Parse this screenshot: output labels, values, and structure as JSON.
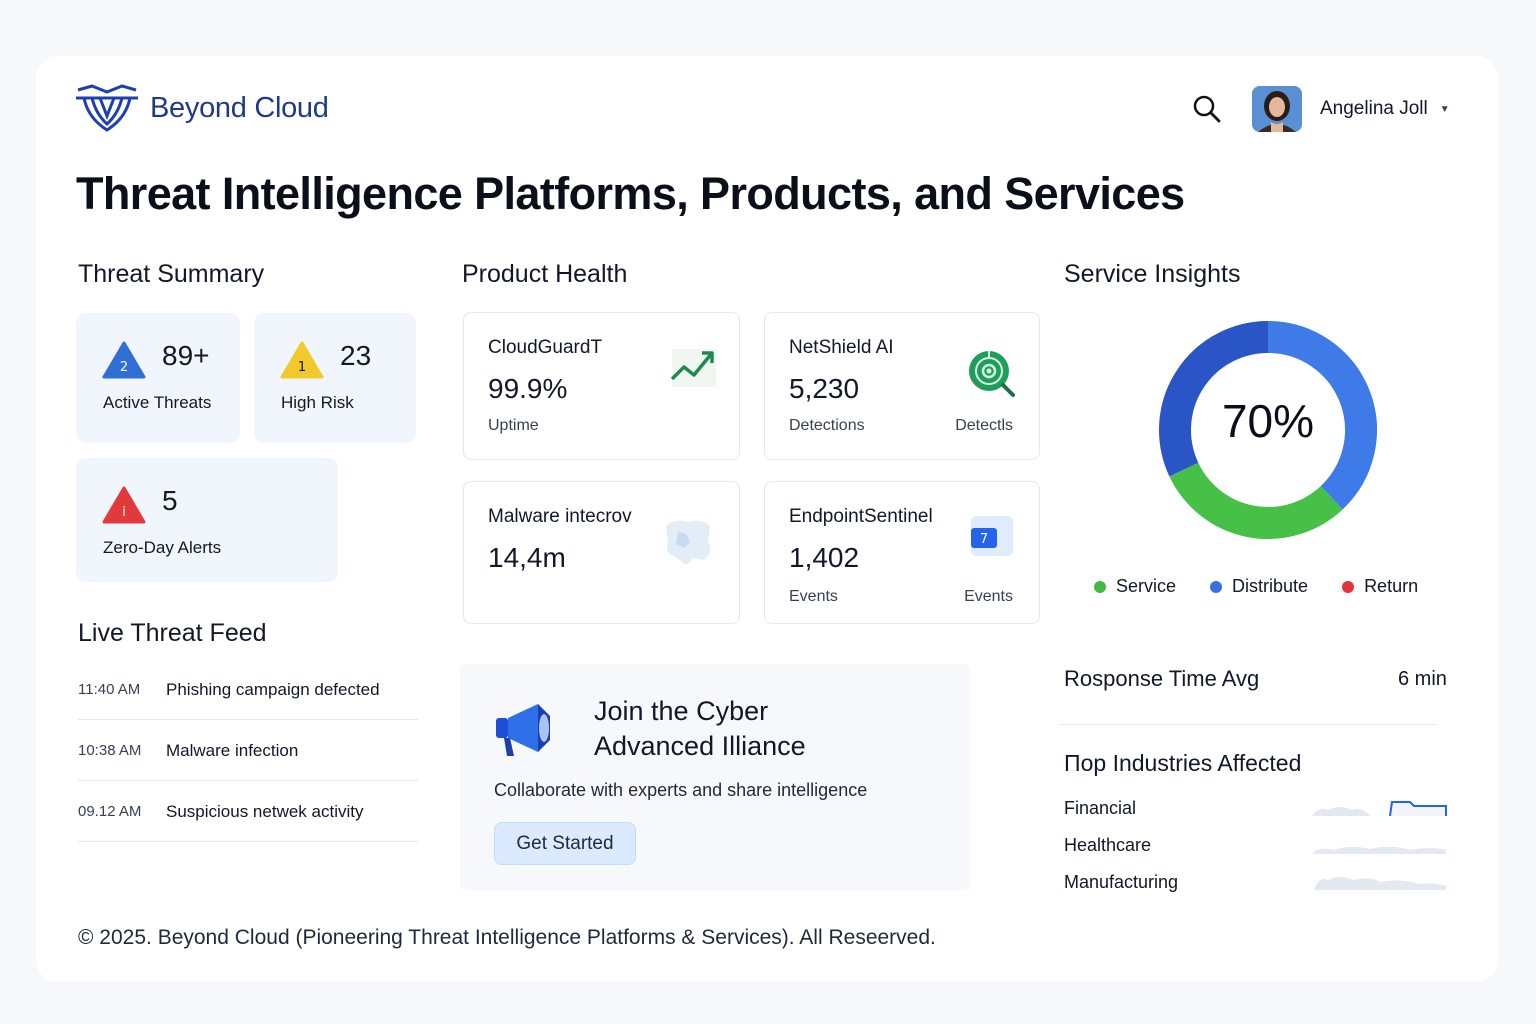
{
  "header": {
    "brand": "Beyond Cloud",
    "user_name": "Angelina Joll"
  },
  "page_title": "Threat Intelligence Platforms, Products, and Services",
  "threat_summary": {
    "title": "Threat Summary",
    "cards": [
      {
        "badge": "2",
        "value": "89+",
        "label": "Active Threats",
        "color": "#2f6fd6"
      },
      {
        "badge": "1",
        "value": "23",
        "label": "High Risk",
        "color": "#f2c92b"
      },
      {
        "badge": "i",
        "value": "5",
        "label": "Zero-Day Alerts",
        "color": "#e03a3a"
      }
    ]
  },
  "live_feed": {
    "title": "Live Threat Feed",
    "items": [
      {
        "time": "11:40 AM",
        "text": "Phishing campaign defected"
      },
      {
        "time": "10:38 AM",
        "text": "Malware infection"
      },
      {
        "time": "09.12 AM",
        "text": "Suspicious netwek activity"
      }
    ]
  },
  "product_health": {
    "title": "Product Health",
    "cards": [
      {
        "name": "CloudGuardT",
        "value": "99.9%",
        "label": "Uptime",
        "label2": "",
        "icon": "trend-up-icon"
      },
      {
        "name": "NetShield AI",
        "value": "5,230",
        "label": "Detections",
        "label2": "Detectls",
        "icon": "radar-icon"
      },
      {
        "name": "Malware intecrov",
        "value": "14,4m",
        "label": "",
        "label2": "",
        "icon": "map-icon"
      },
      {
        "name": "EndpointSentinel",
        "value": "1,402",
        "label": "Events",
        "label2": "Events",
        "icon": "calendar-icon",
        "icon_text": "7"
      }
    ]
  },
  "banner": {
    "title_line1": "Join the Cyber",
    "title_line2": "Advanced Illiance",
    "subtitle": "Collaborate with experts and share intelligence",
    "button": "Get Started"
  },
  "service_insights": {
    "title": "Service Insights",
    "percent_label": "70%",
    "legend": [
      {
        "label": "Service",
        "color": "#43b843"
      },
      {
        "label": "Distribute",
        "color": "#3b6fe0"
      },
      {
        "label": "Return",
        "color": "#e5333b"
      }
    ],
    "response_label": "Rosponse Time Avg",
    "response_value": "6 min",
    "industries_title": "Πop Industries Affected",
    "industries": [
      "Financial",
      "Healthcare",
      "Manufacturing"
    ]
  },
  "chart_data": {
    "type": "pie",
    "title": "",
    "center_label": "70%",
    "categories": [
      "Distribute",
      "Service",
      "Distribute"
    ],
    "values": [
      38,
      30,
      32
    ],
    "colors": [
      "#3f7be8",
      "#47c047",
      "#2a55c7"
    ]
  },
  "footer": "© 2025. Beyond Cloud (Pioneering Threat Intelligence Platforms & Services). All Reseerved."
}
